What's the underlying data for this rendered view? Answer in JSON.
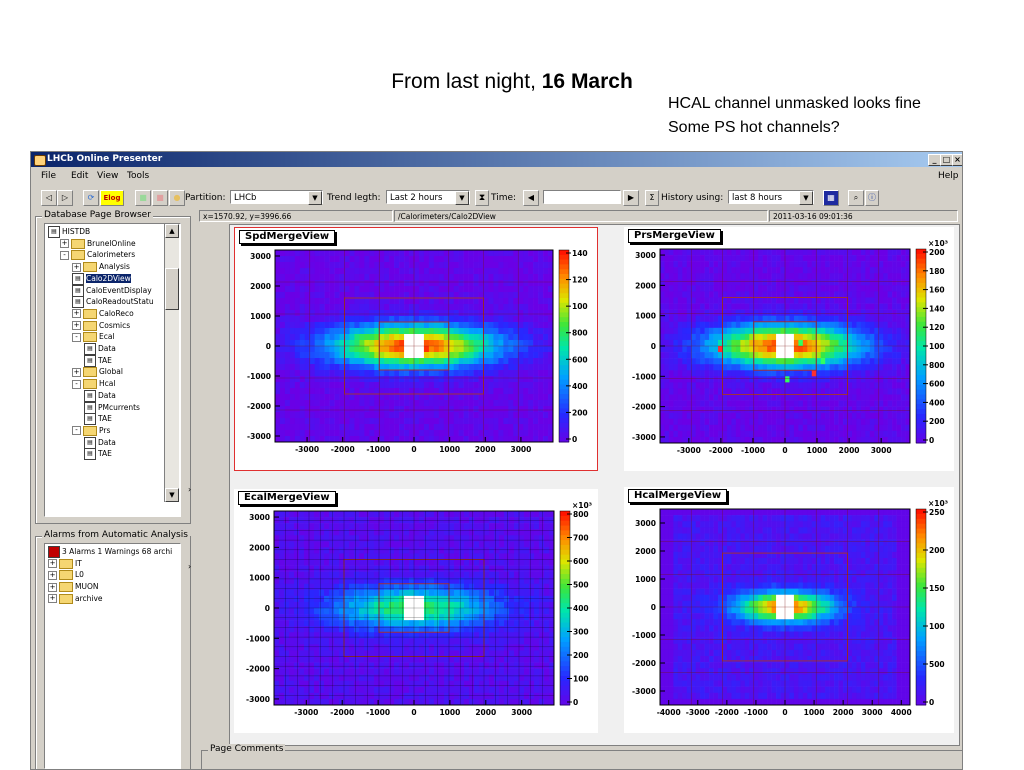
{
  "slide": {
    "title_prefix": "From last night, ",
    "title_bold": "16 March",
    "notes": [
      "HCAL channel unmasked looks fine",
      "Some PS hot channels?"
    ]
  },
  "window": {
    "title": "LHCb Online Presenter",
    "menu": [
      "File",
      "Edit",
      "View",
      "Tools"
    ],
    "help": "Help",
    "controls": [
      "_",
      "□",
      "×"
    ]
  },
  "toolbar": {
    "elog_label": "Elog",
    "partition_label": "Partition:",
    "partition_value": "LHCb",
    "trend_label": "Trend legth:",
    "trend_value": "Last 2 hours",
    "time_label": "Time:",
    "history_label": "History using:",
    "history_value": "last 8 hours"
  },
  "browser": {
    "group_label": "Database Page Browser",
    "nodes": [
      {
        "label": "HISTDB",
        "depth": 0,
        "kind": "root"
      },
      {
        "label": "BrunelOnline",
        "depth": 1,
        "kind": "folder",
        "exp": "+"
      },
      {
        "label": "Calorimeters",
        "depth": 1,
        "kind": "folder",
        "exp": "-"
      },
      {
        "label": "Analysis",
        "depth": 2,
        "kind": "folder",
        "exp": "+"
      },
      {
        "label": "Calo2DView",
        "depth": 2,
        "kind": "page",
        "selected": true
      },
      {
        "label": "CaloEventDisplay",
        "depth": 2,
        "kind": "page"
      },
      {
        "label": "CaloReadoutStatu",
        "depth": 2,
        "kind": "page"
      },
      {
        "label": "CaloReco",
        "depth": 2,
        "kind": "folder",
        "exp": "+"
      },
      {
        "label": "Cosmics",
        "depth": 2,
        "kind": "folder",
        "exp": "+"
      },
      {
        "label": "Ecal",
        "depth": 2,
        "kind": "folder",
        "exp": "-"
      },
      {
        "label": "Data",
        "depth": 3,
        "kind": "page"
      },
      {
        "label": "TAE",
        "depth": 3,
        "kind": "page"
      },
      {
        "label": "Global",
        "depth": 2,
        "kind": "folder",
        "exp": "+"
      },
      {
        "label": "Hcal",
        "depth": 2,
        "kind": "folder",
        "exp": "-"
      },
      {
        "label": "Data",
        "depth": 3,
        "kind": "page"
      },
      {
        "label": "PMcurrents",
        "depth": 3,
        "kind": "page"
      },
      {
        "label": "TAE",
        "depth": 3,
        "kind": "page"
      },
      {
        "label": "Prs",
        "depth": 2,
        "kind": "folder",
        "exp": "-"
      },
      {
        "label": "Data",
        "depth": 3,
        "kind": "page"
      },
      {
        "label": "TAE",
        "depth": 3,
        "kind": "page"
      }
    ]
  },
  "alarms": {
    "group_label": "Alarms from Automatic Analysis",
    "nodes": [
      {
        "label": "3 Alarms 1 Warnings 68 archi",
        "depth": 0,
        "kind": "alarm"
      },
      {
        "label": "IT",
        "depth": 0,
        "kind": "folder",
        "exp": "+"
      },
      {
        "label": "L0",
        "depth": 0,
        "kind": "folder",
        "exp": "+"
      },
      {
        "label": "MUON",
        "depth": 0,
        "kind": "folder",
        "exp": "+"
      },
      {
        "label": "archive",
        "depth": 0,
        "kind": "folder",
        "exp": "+"
      }
    ]
  },
  "status": {
    "coords": "x=1570.92, y=3996.66",
    "path": "/Calorimeters/Calo2DView",
    "timestamp": "2011-03-16 09:01:36"
  },
  "comments_label": "Page Comments",
  "chart_data": [
    {
      "type": "heatmap",
      "title": "SpdMergeView",
      "xticks": [
        -3000,
        -2000,
        -1000,
        0,
        1000,
        2000,
        3000
      ],
      "yticks": [
        3000,
        2000,
        1000,
        0,
        -1000,
        -2000,
        -3000
      ],
      "xlim": [
        -3900,
        3900
      ],
      "ylim": [
        -3200,
        3200
      ],
      "z_ticks": [
        "140",
        "120",
        "100",
        "800",
        "600",
        "400",
        "200",
        "0"
      ],
      "z_exponent": "",
      "shape": "wide",
      "hot_spots": false
    },
    {
      "type": "heatmap",
      "title": "PrsMergeView",
      "xticks": [
        -3000,
        -2000,
        -1000,
        0,
        1000,
        2000,
        3000
      ],
      "yticks": [
        3000,
        2000,
        1000,
        0,
        -1000,
        -2000,
        -3000
      ],
      "xlim": [
        -3900,
        3900
      ],
      "ylim": [
        -3200,
        3200
      ],
      "z_ticks": [
        "200",
        "180",
        "160",
        "140",
        "120",
        "100",
        "800",
        "600",
        "400",
        "200",
        "0"
      ],
      "z_exponent": "×10³",
      "shape": "wide",
      "hot_spots": true
    },
    {
      "type": "heatmap",
      "title": "EcalMergeView",
      "xticks": [
        -3000,
        -2000,
        -1000,
        0,
        1000,
        2000,
        3000
      ],
      "yticks": [
        3000,
        2000,
        1000,
        0,
        -1000,
        -2000,
        -3000
      ],
      "xlim": [
        -3900,
        3900
      ],
      "ylim": [
        -3200,
        3200
      ],
      "z_ticks": [
        "800",
        "700",
        "600",
        "500",
        "400",
        "300",
        "200",
        "100",
        "0"
      ],
      "z_exponent": "×10³",
      "shape": "ecal",
      "hot_spots": false
    },
    {
      "type": "heatmap",
      "title": "HcalMergeView",
      "xticks": [
        -4000,
        -3000,
        -2000,
        -1000,
        0,
        1000,
        2000,
        3000,
        4000
      ],
      "yticks": [
        3000,
        2000,
        1000,
        0,
        -1000,
        -2000,
        -3000
      ],
      "xlim": [
        -4300,
        4300
      ],
      "ylim": [
        -3500,
        3500
      ],
      "z_ticks": [
        "250",
        "200",
        "150",
        "100",
        "500",
        "0"
      ],
      "z_exponent": "×10³",
      "shape": "hcal",
      "hot_spots": false
    }
  ]
}
